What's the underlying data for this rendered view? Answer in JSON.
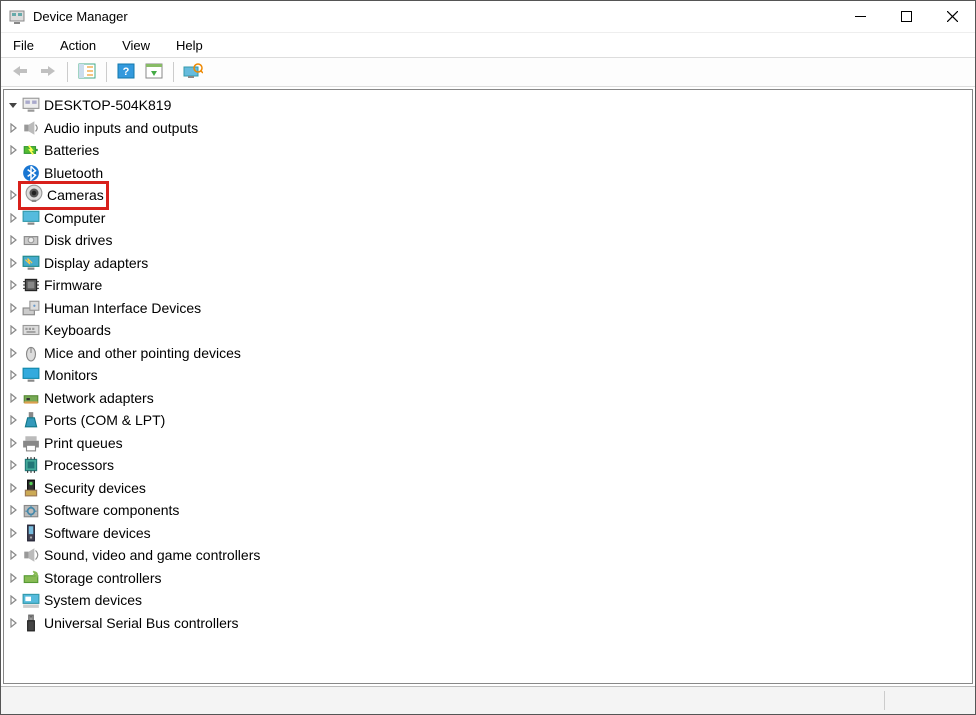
{
  "window": {
    "title": "Device Manager"
  },
  "menu": {
    "file": "File",
    "action": "Action",
    "view": "View",
    "help": "Help"
  },
  "toolbar": {
    "back": "back-arrow-icon",
    "forward": "forward-arrow-icon",
    "show_hide": "show-hide-tree-icon",
    "help": "help-icon",
    "actions": "actions-icon",
    "scan": "scan-hardware-icon"
  },
  "tree": {
    "root": {
      "label": "DESKTOP-504K819",
      "icon": "computer-root-icon",
      "expanded": true
    },
    "children": [
      {
        "label": "Audio inputs and outputs",
        "icon": "speaker-icon"
      },
      {
        "label": "Batteries",
        "icon": "battery-icon"
      },
      {
        "label": "Bluetooth",
        "icon": "bluetooth-icon",
        "noExpand": true
      },
      {
        "label": "Cameras",
        "icon": "camera-icon",
        "highlighted": true
      },
      {
        "label": "Computer",
        "icon": "monitor-icon"
      },
      {
        "label": "Disk drives",
        "icon": "disk-icon"
      },
      {
        "label": "Display adapters",
        "icon": "display-adapter-icon"
      },
      {
        "label": "Firmware",
        "icon": "firmware-icon"
      },
      {
        "label": "Human Interface Devices",
        "icon": "hid-icon"
      },
      {
        "label": "Keyboards",
        "icon": "keyboard-icon"
      },
      {
        "label": "Mice and other pointing devices",
        "icon": "mouse-icon"
      },
      {
        "label": "Monitors",
        "icon": "monitor-blue-icon"
      },
      {
        "label": "Network adapters",
        "icon": "network-adapter-icon"
      },
      {
        "label": "Ports (COM & LPT)",
        "icon": "ports-icon"
      },
      {
        "label": "Print queues",
        "icon": "printer-icon"
      },
      {
        "label": "Processors",
        "icon": "processor-icon"
      },
      {
        "label": "Security devices",
        "icon": "security-icon"
      },
      {
        "label": "Software components",
        "icon": "software-component-icon"
      },
      {
        "label": "Software devices",
        "icon": "software-device-icon"
      },
      {
        "label": "Sound, video and game controllers",
        "icon": "sound-icon"
      },
      {
        "label": "Storage controllers",
        "icon": "storage-icon"
      },
      {
        "label": "System devices",
        "icon": "system-device-icon"
      },
      {
        "label": "Universal Serial Bus controllers",
        "icon": "usb-icon"
      }
    ]
  }
}
